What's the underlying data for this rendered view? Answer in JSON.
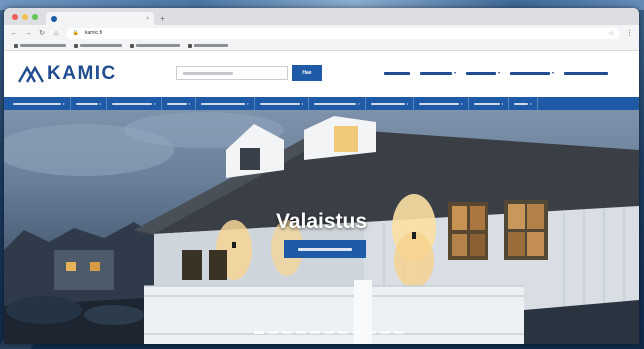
{
  "browser": {
    "tab_title": "",
    "url": "kamic.fi",
    "new_tab_icon": "plus-icon",
    "bookmarks_count": 4
  },
  "header": {
    "logo_text": "KAMIC",
    "search_button": "Hae",
    "top_links_count": 4
  },
  "catnav": {
    "items_count": 11
  },
  "hero": {
    "title": "Valaistus",
    "slides_count": 11,
    "active_slide": 1
  },
  "colors": {
    "brand": "#1f4d8f",
    "accent": "#1f5aa6"
  }
}
